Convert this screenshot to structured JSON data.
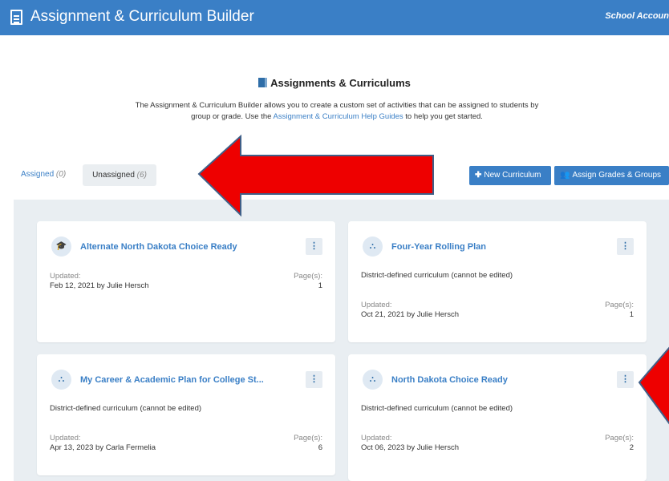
{
  "header": {
    "title": "Assignment & Curriculum Builder",
    "account": "School Accoun"
  },
  "intro": {
    "heading": "Assignments & Curriculums",
    "desc_part1": "The Assignment & Curriculum Builder allows you to create a custom set of activities that can be assigned to students by group or grade. Use the ",
    "desc_link": "Assignment & Curriculum Help Guides",
    "desc_part2": " to help you get started."
  },
  "tabs": {
    "assigned_label": "Assigned",
    "assigned_count": "(0)",
    "unassigned_label": "Unassigned",
    "unassigned_count": "(6)"
  },
  "actions": {
    "new_curriculum": "New Curriculum",
    "assign_grades_groups": "Assign Grades & Groups"
  },
  "cards": [
    {
      "title": "Alternate North Dakota Choice Ready",
      "icon": "graduation-cap-icon",
      "district_note": "",
      "updated_label": "Updated:",
      "updated_value": "Feb 12, 2021 by Julie Hersch",
      "pages_label": "Page(s):",
      "pages_value": "1"
    },
    {
      "title": "Four-Year Rolling Plan",
      "icon": "sitemap-icon",
      "district_note": "District-defined curriculum (cannot be edited)",
      "updated_label": "Updated:",
      "updated_value": "Oct 21, 2021 by Julie Hersch",
      "pages_label": "Page(s):",
      "pages_value": "1"
    },
    {
      "title": "My Career & Academic Plan for College St...",
      "icon": "sitemap-icon",
      "district_note": "District-defined curriculum (cannot be edited)",
      "updated_label": "Updated:",
      "updated_value": "Apr 13, 2023 by Carla Fermelia",
      "pages_label": "Page(s):",
      "pages_value": "6"
    },
    {
      "title": "North Dakota Choice Ready",
      "icon": "sitemap-icon",
      "district_note": "District-defined curriculum (cannot be edited)",
      "updated_label": "Updated:",
      "updated_value": "Oct 06, 2023 by Julie Hersch",
      "pages_label": "Page(s):",
      "pages_value": "2"
    }
  ],
  "colors": {
    "brand": "#3a7fc6",
    "board_bg": "#e9eef2",
    "annotation_arrow": "#ee0000"
  }
}
